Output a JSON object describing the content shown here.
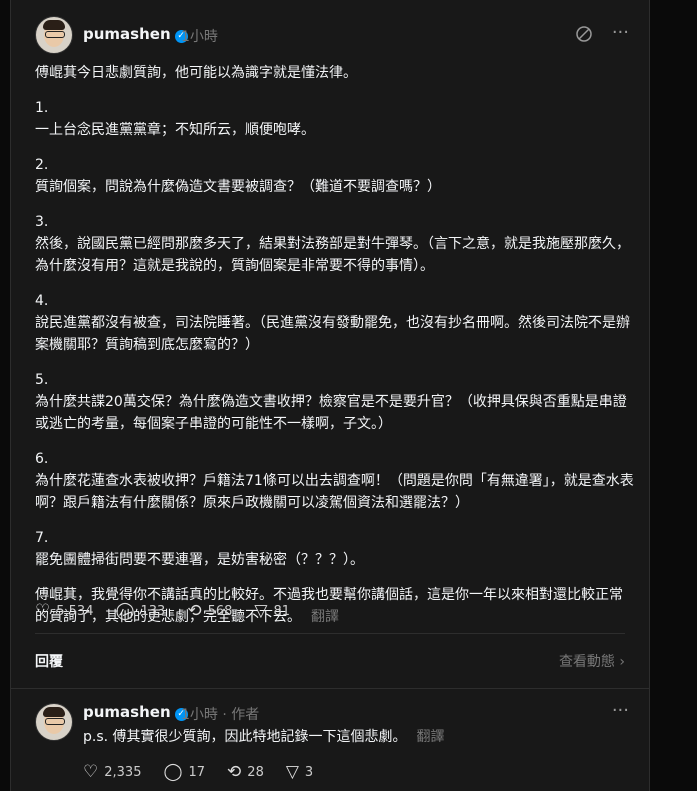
{
  "post": {
    "username": "pumashen",
    "time": "1小時",
    "paragraphs": [
      {
        "num": "",
        "text": "傅崐萁今日悲劇質詢，他可能以為識字就是懂法律。"
      },
      {
        "num": "1.",
        "text": "一上台念民進黨黨章；不知所云，順便咆哮。"
      },
      {
        "num": "2.",
        "text": "質詢個案，問說為什麼偽造文書要被調查？（難道不要調查嗎？）"
      },
      {
        "num": "3.",
        "text": "然後，說國民黨已經問那麼多天了，結果對法務部是對牛彈琴。（言下之意，就是我施壓那麼久，為什麼沒有用？這就是我說的，質詢個案是非常要不得的事情）。"
      },
      {
        "num": "4.",
        "text": "說民進黨都沒有被查，司法院睡著。（民進黨沒有發動罷免，也沒有抄名冊啊。然後司法院不是辦案機關耶？質詢稿到底怎麼寫的？）"
      },
      {
        "num": "5.",
        "text": "為什麼共諜20萬交保？為什麼偽造文書收押？檢察官是不是要升官？（收押具保與否重點是串證或逃亡的考量，每個案子串證的可能性不一樣啊，子文。）"
      },
      {
        "num": "6.",
        "text": "為什麼花蓮查水表被收押？戶籍法71條可以出去調查啊！（問題是你問「有無違署」，就是查水表啊？跟戶籍法有什麼關係？原來戶政機關可以凌駕個資法和選罷法？）"
      },
      {
        "num": "7.",
        "text": "罷免團體掃街問要不要連署，是妨害秘密（？？？）。"
      },
      {
        "num": "",
        "text": "傅崐萁，我覺得你不講話真的比較好。不過我也要幫你講個話，這是你一年以來相對還比較正常的質詢了，其他的更悲劇，完全聽不下去。"
      }
    ],
    "translate": "翻譯",
    "likes": "5,534",
    "comments": "133",
    "reposts": "568",
    "shares": "81"
  },
  "replies": {
    "title": "回覆",
    "view_activity": "查看動態"
  },
  "reply": {
    "username": "pumashen",
    "time": "1小時",
    "author_tag": "作者",
    "text": "p.s. 傅其實很少質詢，因此特地記錄一下這個悲劇。",
    "translate": "翻譯",
    "likes": "2,335",
    "comments": "17",
    "reposts": "28",
    "shares": "3"
  }
}
